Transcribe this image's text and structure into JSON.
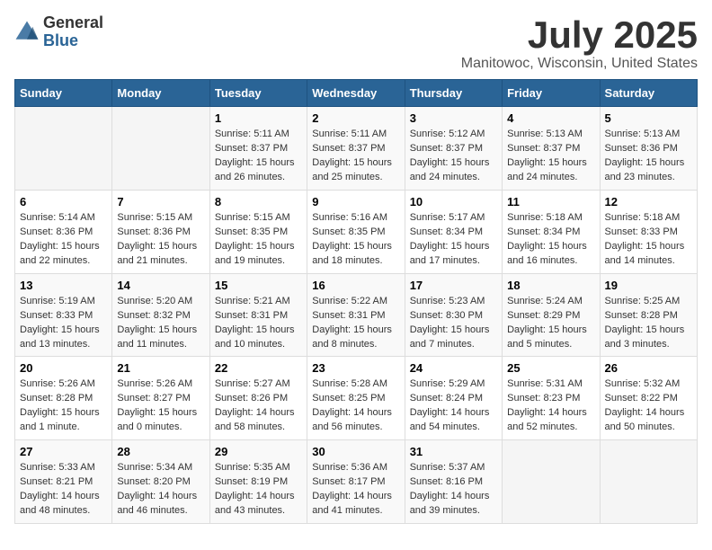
{
  "logo": {
    "general": "General",
    "blue": "Blue"
  },
  "header": {
    "month": "July 2025",
    "location": "Manitowoc, Wisconsin, United States"
  },
  "days_of_week": [
    "Sunday",
    "Monday",
    "Tuesday",
    "Wednesday",
    "Thursday",
    "Friday",
    "Saturday"
  ],
  "weeks": [
    [
      {
        "day": "",
        "info": ""
      },
      {
        "day": "",
        "info": ""
      },
      {
        "day": "1",
        "sunrise": "Sunrise: 5:11 AM",
        "sunset": "Sunset: 8:37 PM",
        "daylight": "Daylight: 15 hours and 26 minutes."
      },
      {
        "day": "2",
        "sunrise": "Sunrise: 5:11 AM",
        "sunset": "Sunset: 8:37 PM",
        "daylight": "Daylight: 15 hours and 25 minutes."
      },
      {
        "day": "3",
        "sunrise": "Sunrise: 5:12 AM",
        "sunset": "Sunset: 8:37 PM",
        "daylight": "Daylight: 15 hours and 24 minutes."
      },
      {
        "day": "4",
        "sunrise": "Sunrise: 5:13 AM",
        "sunset": "Sunset: 8:37 PM",
        "daylight": "Daylight: 15 hours and 24 minutes."
      },
      {
        "day": "5",
        "sunrise": "Sunrise: 5:13 AM",
        "sunset": "Sunset: 8:36 PM",
        "daylight": "Daylight: 15 hours and 23 minutes."
      }
    ],
    [
      {
        "day": "6",
        "sunrise": "Sunrise: 5:14 AM",
        "sunset": "Sunset: 8:36 PM",
        "daylight": "Daylight: 15 hours and 22 minutes."
      },
      {
        "day": "7",
        "sunrise": "Sunrise: 5:15 AM",
        "sunset": "Sunset: 8:36 PM",
        "daylight": "Daylight: 15 hours and 21 minutes."
      },
      {
        "day": "8",
        "sunrise": "Sunrise: 5:15 AM",
        "sunset": "Sunset: 8:35 PM",
        "daylight": "Daylight: 15 hours and 19 minutes."
      },
      {
        "day": "9",
        "sunrise": "Sunrise: 5:16 AM",
        "sunset": "Sunset: 8:35 PM",
        "daylight": "Daylight: 15 hours and 18 minutes."
      },
      {
        "day": "10",
        "sunrise": "Sunrise: 5:17 AM",
        "sunset": "Sunset: 8:34 PM",
        "daylight": "Daylight: 15 hours and 17 minutes."
      },
      {
        "day": "11",
        "sunrise": "Sunrise: 5:18 AM",
        "sunset": "Sunset: 8:34 PM",
        "daylight": "Daylight: 15 hours and 16 minutes."
      },
      {
        "day": "12",
        "sunrise": "Sunrise: 5:18 AM",
        "sunset": "Sunset: 8:33 PM",
        "daylight": "Daylight: 15 hours and 14 minutes."
      }
    ],
    [
      {
        "day": "13",
        "sunrise": "Sunrise: 5:19 AM",
        "sunset": "Sunset: 8:33 PM",
        "daylight": "Daylight: 15 hours and 13 minutes."
      },
      {
        "day": "14",
        "sunrise": "Sunrise: 5:20 AM",
        "sunset": "Sunset: 8:32 PM",
        "daylight": "Daylight: 15 hours and 11 minutes."
      },
      {
        "day": "15",
        "sunrise": "Sunrise: 5:21 AM",
        "sunset": "Sunset: 8:31 PM",
        "daylight": "Daylight: 15 hours and 10 minutes."
      },
      {
        "day": "16",
        "sunrise": "Sunrise: 5:22 AM",
        "sunset": "Sunset: 8:31 PM",
        "daylight": "Daylight: 15 hours and 8 minutes."
      },
      {
        "day": "17",
        "sunrise": "Sunrise: 5:23 AM",
        "sunset": "Sunset: 8:30 PM",
        "daylight": "Daylight: 15 hours and 7 minutes."
      },
      {
        "day": "18",
        "sunrise": "Sunrise: 5:24 AM",
        "sunset": "Sunset: 8:29 PM",
        "daylight": "Daylight: 15 hours and 5 minutes."
      },
      {
        "day": "19",
        "sunrise": "Sunrise: 5:25 AM",
        "sunset": "Sunset: 8:28 PM",
        "daylight": "Daylight: 15 hours and 3 minutes."
      }
    ],
    [
      {
        "day": "20",
        "sunrise": "Sunrise: 5:26 AM",
        "sunset": "Sunset: 8:28 PM",
        "daylight": "Daylight: 15 hours and 1 minute."
      },
      {
        "day": "21",
        "sunrise": "Sunrise: 5:26 AM",
        "sunset": "Sunset: 8:27 PM",
        "daylight": "Daylight: 15 hours and 0 minutes."
      },
      {
        "day": "22",
        "sunrise": "Sunrise: 5:27 AM",
        "sunset": "Sunset: 8:26 PM",
        "daylight": "Daylight: 14 hours and 58 minutes."
      },
      {
        "day": "23",
        "sunrise": "Sunrise: 5:28 AM",
        "sunset": "Sunset: 8:25 PM",
        "daylight": "Daylight: 14 hours and 56 minutes."
      },
      {
        "day": "24",
        "sunrise": "Sunrise: 5:29 AM",
        "sunset": "Sunset: 8:24 PM",
        "daylight": "Daylight: 14 hours and 54 minutes."
      },
      {
        "day": "25",
        "sunrise": "Sunrise: 5:31 AM",
        "sunset": "Sunset: 8:23 PM",
        "daylight": "Daylight: 14 hours and 52 minutes."
      },
      {
        "day": "26",
        "sunrise": "Sunrise: 5:32 AM",
        "sunset": "Sunset: 8:22 PM",
        "daylight": "Daylight: 14 hours and 50 minutes."
      }
    ],
    [
      {
        "day": "27",
        "sunrise": "Sunrise: 5:33 AM",
        "sunset": "Sunset: 8:21 PM",
        "daylight": "Daylight: 14 hours and 48 minutes."
      },
      {
        "day": "28",
        "sunrise": "Sunrise: 5:34 AM",
        "sunset": "Sunset: 8:20 PM",
        "daylight": "Daylight: 14 hours and 46 minutes."
      },
      {
        "day": "29",
        "sunrise": "Sunrise: 5:35 AM",
        "sunset": "Sunset: 8:19 PM",
        "daylight": "Daylight: 14 hours and 43 minutes."
      },
      {
        "day": "30",
        "sunrise": "Sunrise: 5:36 AM",
        "sunset": "Sunset: 8:17 PM",
        "daylight": "Daylight: 14 hours and 41 minutes."
      },
      {
        "day": "31",
        "sunrise": "Sunrise: 5:37 AM",
        "sunset": "Sunset: 8:16 PM",
        "daylight": "Daylight: 14 hours and 39 minutes."
      },
      {
        "day": "",
        "info": ""
      },
      {
        "day": "",
        "info": ""
      }
    ]
  ]
}
